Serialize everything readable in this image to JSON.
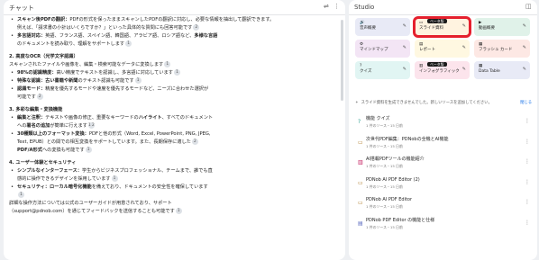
{
  "chat": {
    "title": "チャット",
    "lines": [
      {
        "type": "bullet",
        "bold": "スキャン後PDFの翻訳：",
        "text": "PDFの形式を保ったままスキャンしたPDFの翻訳に対応し、必要な情報を抽出して翻訳できます。",
        "cite": ""
      },
      {
        "type": "plain",
        "text": "例えば、「請求書の小計はいくらですか？」といった具体的な質問にも回答可能です",
        "cite": "2"
      },
      {
        "type": "bullet",
        "bold": "多言語対応：",
        "text": "英語、フランス語、スペイン語、韓国語、アラビア語、ロシア語など、",
        "bold2": "多様な言語",
        "cite": ""
      },
      {
        "type": "plain",
        "text": "のドキュメントを読み取り、理解をサポートします",
        "cite": "1"
      },
      {
        "type": "section",
        "text": "2. 高度なOCR（光学文字認識）"
      },
      {
        "type": "body",
        "text": "スキャンされたファイルや画像を、編集・検索可能なデータに変換します",
        "cite": "1"
      },
      {
        "type": "bullet",
        "bold": "98%の認識精度：",
        "text": "高い精度でテキストを認識し、多言語に対応しています",
        "cite": "1"
      },
      {
        "type": "bullet",
        "bold": "特殊な認識：",
        "text": "",
        "bold2": "古い書籍や新聞",
        "text2": "のテキスト認識も可能です",
        "cite": "1"
      },
      {
        "type": "bullet",
        "bold": "認識モード：",
        "text": "精度を優先するモードや速度を優先するモードなど、ニーズに合わせた選択が",
        "cite": ""
      },
      {
        "type": "plain",
        "text": "可能です",
        "cite": "2"
      },
      {
        "type": "section",
        "text": "3. 多彩な編集・変換機能"
      },
      {
        "type": "bullet",
        "bold": "編集と注釈：",
        "text": "テキストや画像の修正、重要なキーワードの",
        "bold2": "ハイライト",
        "text2": "、すべてのドキュメント",
        "cite": ""
      },
      {
        "type": "plain",
        "text": "への",
        "bold2": "署名の追加",
        "text2": "が簡単に行えます",
        "cite": "1 2"
      },
      {
        "type": "bullet",
        "bold": "30種類以上のフォーマット変換：",
        "text": "PDFと他の形式（Word, Excel, PowerPoint, PNG, JPEG,",
        "cite": ""
      },
      {
        "type": "plain",
        "text": "Text, EPUB）との間での相互変換をサポートしています",
        "cite": "2",
        "text2": "。また、長期保存に適した",
        "cite2": ""
      },
      {
        "type": "plain",
        "bold2": "PDF/A形式",
        "text2": "への変換も可能です",
        "cite": "1"
      },
      {
        "type": "section",
        "text": "4. ユーザー体験とセキュリティ"
      },
      {
        "type": "bullet",
        "bold": "シンプルなインターフェース：",
        "text": "学生からビジネスプロフェッショナル、チームまで、誰でも直",
        "cite": ""
      },
      {
        "type": "plain",
        "text": "感的に操作できるデザインを採用しています",
        "cite": "1"
      },
      {
        "type": "bullet",
        "bold": "セキュリティ：",
        "bold2": "ローカル暗号化機能",
        "text2": "を備えており、ドキュメントの安全性を確保しています",
        "cite": ""
      },
      {
        "type": "plain",
        "text": "",
        "cite": "1"
      },
      {
        "type": "body",
        "text": "詳細な操作方法については公式のユーザーガイドが用意されており、サポート",
        "cite": ""
      },
      {
        "type": "body",
        "text": "（support@pdnob.com）を通じてフィードバックを送信することも可能です",
        "cite": "1"
      }
    ]
  },
  "studio": {
    "title": "Studio",
    "tiles": [
      {
        "icon": "waveform-icon",
        "glyph": "🔊",
        "label": "音声概要",
        "bg": "#e8eaf6",
        "badge": "",
        "highlight": false
      },
      {
        "icon": "slides-icon",
        "glyph": "▭",
        "label": "スライド資料",
        "bg": "#fff3e0",
        "badge": "ベータ版",
        "highlight": true
      },
      {
        "icon": "video-icon",
        "glyph": "▶",
        "label": "動画概要",
        "bg": "#e0f2e9",
        "badge": "",
        "highlight": false
      },
      {
        "icon": "mindmap-icon",
        "glyph": "⚙",
        "label": "マインドマップ",
        "bg": "#f3e5f5",
        "badge": "",
        "highlight": false
      },
      {
        "icon": "report-icon",
        "glyph": "▤",
        "label": "レポート",
        "bg": "#fff8e1",
        "badge": "",
        "highlight": false
      },
      {
        "icon": "flashcard-icon",
        "glyph": "▦",
        "label": "フラッシュ カード",
        "bg": "#fde8e4",
        "badge": "",
        "highlight": false
      },
      {
        "icon": "quiz-icon",
        "glyph": "?",
        "label": "クイズ",
        "bg": "#e1f5f3",
        "badge": "",
        "highlight": false
      },
      {
        "icon": "infographic-icon",
        "glyph": "▥",
        "label": "インフォグラフィック",
        "bg": "#fce4ec",
        "badge": "ベータ版",
        "highlight": false
      },
      {
        "icon": "datatable-icon",
        "glyph": "▦",
        "label": "Data Table",
        "bg": "#e8eaf6",
        "badge": "",
        "highlight": false
      }
    ],
    "notice": "スライド資料を生成できませんでした。新しいソースを追加してください。",
    "notice_link": "閉じる",
    "notes": [
      {
        "icon": "quiz-icon",
        "glyph": "?",
        "color": "#2a9d8f",
        "title": "機能 クイズ",
        "sub": "1 件のソース・15 日前"
      },
      {
        "icon": "slides-icon",
        "glyph": "▭",
        "color": "#b07d2b",
        "title": "次世代PDF編集：PDNobの全機とAI機能",
        "sub": "1 件のソース・15 日前"
      },
      {
        "icon": "infographic-icon",
        "glyph": "▥",
        "color": "#c2185b",
        "title": "AI搭載PDFツールの機能紹介",
        "sub": "1 件のソース・15 日前"
      },
      {
        "icon": "slides-icon",
        "glyph": "▭",
        "color": "#b07d2b",
        "title": "PDNob AI PDF Editor (2)",
        "sub": "1 件のソース・15 日前"
      },
      {
        "icon": "slides-icon",
        "glyph": "▭",
        "color": "#b07d2b",
        "title": "PDNob AI PDF Editor",
        "sub": "1 件のソース・15 日前"
      },
      {
        "icon": "report-icon",
        "glyph": "▤",
        "color": "#5c6bc0",
        "title": "PDNob PDF Editor の機能と仕様",
        "sub": "1 件のソース・15 日前"
      }
    ]
  }
}
